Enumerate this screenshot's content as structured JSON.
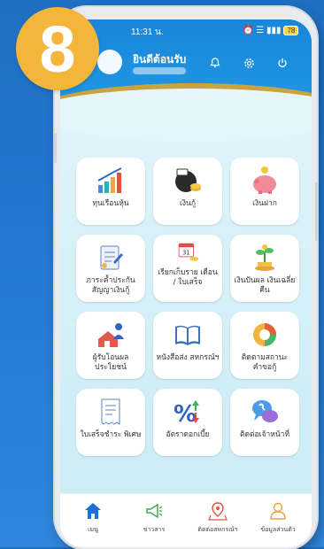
{
  "badge": {
    "number": "8"
  },
  "status_bar": {
    "time": "11:31 น.",
    "battery": "78"
  },
  "header": {
    "welcome": "ยินดีต้อนรับ"
  },
  "menu": [
    {
      "label": "ทุนเรือนหุ้น",
      "icon": "growth-chart-icon"
    },
    {
      "label": "เงินกู้",
      "icon": "loan-money-bag-icon"
    },
    {
      "label": "เงินฝาก",
      "icon": "piggy-bank-icon"
    },
    {
      "label": "ภาระค้ำประกัน สัญญาเงินกู้",
      "icon": "guarantee-contract-icon"
    },
    {
      "label": "เรียกเก็บราย เดือน / ใบเสร็จ",
      "icon": "monthly-billing-icon"
    },
    {
      "label": "เงินปันผล เงินเฉลี่ยคืน",
      "icon": "dividend-plant-icon"
    },
    {
      "label": "ผู้รับโอนผล ประโยชน์",
      "icon": "beneficiary-icon"
    },
    {
      "label": "หนังสือส่ง สหกรณ์ฯ",
      "icon": "open-book-icon"
    },
    {
      "label": "ติดตามสถานะ คำขอกู้",
      "icon": "status-tracking-icon"
    },
    {
      "label": "ใบเสร็จชำระ พิเศษ",
      "icon": "receipt-icon"
    },
    {
      "label": "อัตราดอกเบี้ย",
      "icon": "interest-rate-icon"
    },
    {
      "label": "ติดต่อเจ้าหน้าที่",
      "icon": "contact-chat-icon"
    }
  ],
  "nav": [
    {
      "label": "เมนู",
      "icon": "home-icon",
      "active": true
    },
    {
      "label": "ข่าวสาร",
      "icon": "megaphone-icon"
    },
    {
      "label": "ติดต่อสหกรณ์ฯ",
      "icon": "map-pin-icon"
    },
    {
      "label": "ข้อมูลส่วนตัว",
      "icon": "person-icon"
    }
  ],
  "colors": {
    "header": "#1a86d9",
    "accent_gold": "#c9a33e",
    "badge": "#f3b53a",
    "nav_active": "#1c6fd6"
  }
}
